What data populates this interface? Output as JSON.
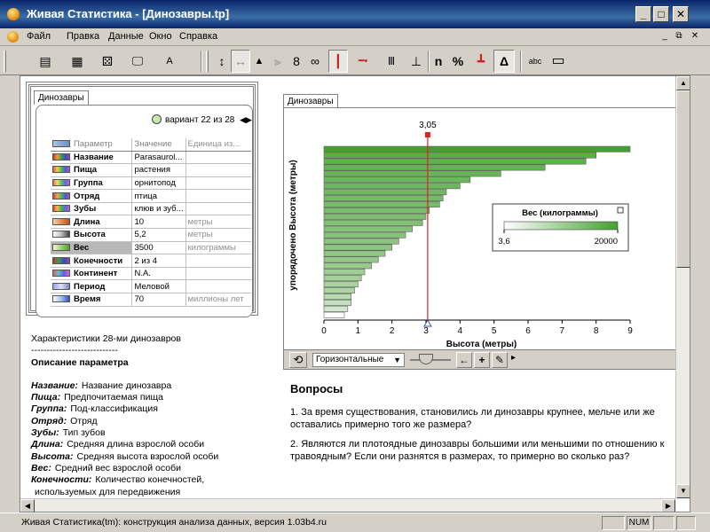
{
  "window": {
    "title": "Живая Статистика - [Динозавры.tp]",
    "controls": {
      "minimize": "_",
      "maximize": "□",
      "close": "✕"
    }
  },
  "menu": {
    "items": [
      "Файл",
      "Правка",
      "Данные",
      "Окно",
      "Справка"
    ],
    "doc_controls": [
      "_",
      "⧉",
      "✕"
    ]
  },
  "toolbar": {
    "buttons": [
      {
        "name": "card-view",
        "glyph": "▤"
      },
      {
        "name": "table-view",
        "glyph": "▦"
      },
      {
        "name": "dice",
        "glyph": "⚄"
      },
      {
        "name": "monitor",
        "glyph": "🖵"
      },
      {
        "name": "text-box",
        "glyph": "A"
      },
      {
        "name": "vertical-arrow",
        "glyph": "↕"
      },
      {
        "name": "horizontal-arrow",
        "glyph": "↔"
      },
      {
        "name": "pyramid",
        "glyph": "▲"
      },
      {
        "name": "bars-right",
        "glyph": "⫸"
      },
      {
        "name": "chain-v",
        "glyph": "8"
      },
      {
        "name": "chain-h",
        "glyph": "∞"
      },
      {
        "name": "pin-red",
        "glyph": "┃"
      },
      {
        "name": "line-red",
        "glyph": "━•"
      },
      {
        "name": "brackets",
        "glyph": "Ⅲ"
      },
      {
        "name": "underline",
        "glyph": "⊥"
      },
      {
        "name": "n-count",
        "glyph": "n"
      },
      {
        "name": "percent",
        "glyph": "%"
      },
      {
        "name": "base-red",
        "glyph": "┻"
      },
      {
        "name": "delta",
        "glyph": "Δ"
      },
      {
        "name": "abc",
        "glyph": "abc"
      },
      {
        "name": "legend",
        "glyph": "▭"
      }
    ]
  },
  "sheet": {
    "tab": "Динозавры",
    "variant_text": "вариант 22 из 28",
    "columns": [
      "Параметр",
      "Значение",
      "Единица из..."
    ],
    "rows": [
      {
        "param": "Название",
        "value": "Parasaurol...",
        "unit": ""
      },
      {
        "param": "Пища",
        "value": "растения",
        "unit": ""
      },
      {
        "param": "Группа",
        "value": "орнитопод",
        "unit": ""
      },
      {
        "param": "Отряд",
        "value": "птица",
        "unit": ""
      },
      {
        "param": "Зубы",
        "value": "клюв и зуб...",
        "unit": ""
      },
      {
        "param": "Длина",
        "value": "10",
        "unit": "метры"
      },
      {
        "param": "Высота",
        "value": "5,2",
        "unit": "метры"
      },
      {
        "param": "Вес",
        "value": "3500",
        "unit": "килограммы"
      },
      {
        "param": "Конечности",
        "value": "2 из 4",
        "unit": ""
      },
      {
        "param": "Континент",
        "value": "N.A.",
        "unit": ""
      },
      {
        "param": "Период",
        "value": "Меловой",
        "unit": ""
      },
      {
        "param": "Время",
        "value": "70",
        "unit": "миллионы лет"
      }
    ],
    "swatch_colors": [
      [
        "#d03030",
        "#f0a030",
        "#40a040",
        "#3050d0",
        "#a040a0"
      ],
      [
        "#e05050",
        "#f0d040",
        "#50c050",
        "#4060e0",
        "#c050c0"
      ],
      [
        "#f06060",
        "#f0e060",
        "#60c060",
        "#5070e0",
        "#d060d0"
      ],
      [
        "#d04040",
        "#e0b050",
        "#60b060",
        "#4060d0",
        "#b050b0"
      ],
      [
        "#e04040",
        "#f0c040",
        "#50b050",
        "#5070d0",
        "#c060c0"
      ],
      [
        "#f0d0b0",
        "#e09050",
        "#c05020"
      ],
      [
        "#ffffff",
        "#c0c0c0",
        "#404040"
      ],
      [
        "#f0f8e0",
        "#a0d070",
        "#50a030"
      ],
      [
        "#c03030",
        "#40a040",
        "#3050c0",
        "#a040a0"
      ],
      [
        "#e06060",
        "#60c0c0",
        "#6060e0",
        "#e060e0"
      ],
      [
        "#a0a0f0",
        "#e0e0f0",
        "#8080c0"
      ],
      [
        "#ffffff",
        "#a0c0f0",
        "#3050c0"
      ]
    ],
    "header_swatch": [
      "#a8c4e8",
      "#6890c8"
    ]
  },
  "description": {
    "heading": "Характеристики 28-ми динозавров",
    "divider": "----------------------------",
    "section_title": "Описание параметра",
    "items": [
      {
        "term": "Название:",
        "text": "Название динозавра"
      },
      {
        "term": "Пища:",
        "text": "Предпочитаемая пища"
      },
      {
        "term": "Группа:",
        "text": "Под-классификация"
      },
      {
        "term": "Отряд:",
        "text": "Отряд"
      },
      {
        "term": "Зубы:",
        "text": "Тип зубов"
      },
      {
        "term": "Длина:",
        "text": "Средняя длина взрослой особи"
      },
      {
        "term": "Высота:",
        "text": "Средняя высота взрослой особи"
      },
      {
        "term": "Вес:",
        "text": "Средний вес взрослой особи"
      },
      {
        "term": "Конечности:",
        "text": "Количество конечностей,"
      },
      {
        "term": "",
        "text": "используемых для передвижения"
      }
    ]
  },
  "chart_panel": {
    "tab": "Динозавры",
    "orientation_select": "Горизонтальные",
    "tools": [
      "←",
      "+",
      "✎",
      "▸"
    ]
  },
  "chart_data": {
    "type": "bar",
    "orientation": "horizontal",
    "xlabel": "Высота (метры)",
    "ylabel": "упорядочено Высота (метры)",
    "xlim": [
      0,
      9
    ],
    "xticks": [
      0,
      1,
      2,
      3,
      4,
      5,
      6,
      7,
      8,
      9
    ],
    "marker_value": 3.05,
    "marker_label": "3,05",
    "marker_color": "#e02020",
    "heights": [
      9.0,
      8.0,
      7.7,
      6.5,
      5.2,
      4.3,
      4.0,
      3.6,
      3.5,
      3.4,
      3.1,
      3.0,
      2.9,
      2.6,
      2.4,
      2.2,
      2.0,
      1.8,
      1.6,
      1.4,
      1.2,
      1.1,
      1.0,
      0.9,
      0.8,
      0.8,
      0.7,
      0.6
    ],
    "weights": [
      20000,
      6000,
      5000,
      4500,
      3500,
      3000,
      2700,
      2400,
      2000,
      1800,
      1500,
      1300,
      1200,
      1000,
      900,
      800,
      700,
      600,
      500,
      400,
      300,
      250,
      200,
      150,
      100,
      60,
      30,
      3.6
    ],
    "legend": {
      "title": "Вес (килограммы)",
      "min_label": "3,6",
      "max_label": "20000",
      "min_value": 3.6,
      "max_value": 20000,
      "color_low": "#ffffff",
      "color_high": "#44a030"
    }
  },
  "questions": {
    "title": "Вопросы",
    "items": [
      "1.  За время существования, становились ли динозавры крупнее, мельче или же оставались примерно того же размера?",
      "2.  Являются ли плотоядные динозавры большими или меньшими по отношению к травоядным? Если они разнятся в размерах, то примерно во сколько раз?"
    ]
  },
  "statusbar": {
    "text": "Живая Статистика(tm): конструкция анализа данных, версия 1.03b4.ru",
    "num": "NUM"
  }
}
